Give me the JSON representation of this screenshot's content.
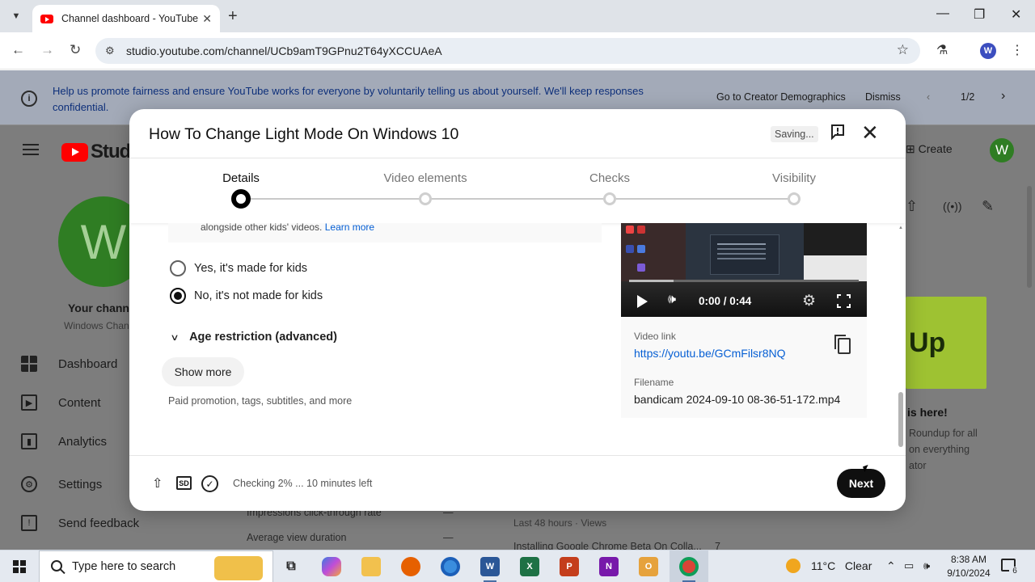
{
  "browser": {
    "tab_title": "Channel dashboard - YouTube",
    "url": "studio.youtube.com/channel/UCb9amT9GPnu2T64yXCCUAeA",
    "profile_initial": "W"
  },
  "banner": {
    "text": "Help us promote fairness and ensure YouTube works for everyone by voluntarily telling us about yourself. We'll keep responses confidential.",
    "link": "Go to Creator Demographics",
    "dismiss": "Dismiss",
    "pager": "1/2"
  },
  "studio": {
    "logo_text": "Studi",
    "create": "Create",
    "avatar_initial": "W",
    "channel_initial": "W",
    "channel_name": "Your chann",
    "channel_sub": "Windows Chan",
    "sidebar": [
      {
        "label": "Dashboard",
        "icon": "dashboard-icon"
      },
      {
        "label": "Content",
        "icon": "content-icon"
      },
      {
        "label": "Analytics",
        "icon": "analytics-icon"
      },
      {
        "label": "Settings",
        "icon": "settings-icon"
      },
      {
        "label": "Send feedback",
        "icon": "feedback-icon"
      }
    ],
    "promo": {
      "card_text": "Up",
      "title": "is here!",
      "lines": [
        "Roundup for all",
        "on everything",
        "ator"
      ]
    },
    "bottom": {
      "impressions": "Impressions click-through rate",
      "avg_view": "Average view duration",
      "dash1": "—",
      "dash2": "—",
      "last48": "Last 48 hours · Views",
      "installing": "Installing Google Chrome Beta On Colla...",
      "count": "7"
    }
  },
  "dialog": {
    "title": "How To Change Light Mode On Windows 10",
    "saving": "Saving...",
    "steps": [
      {
        "label": "Details",
        "active": true
      },
      {
        "label": "Video elements",
        "active": false
      },
      {
        "label": "Checks",
        "active": false
      },
      {
        "label": "Visibility",
        "active": false
      }
    ],
    "kids_note": "alongside other kids' videos.",
    "learn_more": "Learn more",
    "radio_yes": "Yes, it's made for kids",
    "radio_no": "No, it's not made for kids",
    "radio_selected": "no",
    "age_restriction": "Age restriction (advanced)",
    "show_more": "Show more",
    "paid_text": "Paid promotion, tags, subtitles, and more",
    "video": {
      "time": "0:00 / 0:44",
      "progress_fraction": 0,
      "link_label": "Video link",
      "link": "https://youtu.be/GCmFilsr8NQ",
      "filename_label": "Filename",
      "filename": "bandicam 2024-09-10 08-36-51-172.mp4"
    },
    "footer": {
      "sd": "SD",
      "checking": "Checking 2% ... 10 minutes left",
      "next": "Next"
    }
  },
  "taskbar": {
    "search_placeholder": "Type here to search",
    "weather_temp": "11°C",
    "weather_text": "Clear",
    "time": "8:38 AM",
    "date": "9/10/2024",
    "notif_count": "6"
  }
}
